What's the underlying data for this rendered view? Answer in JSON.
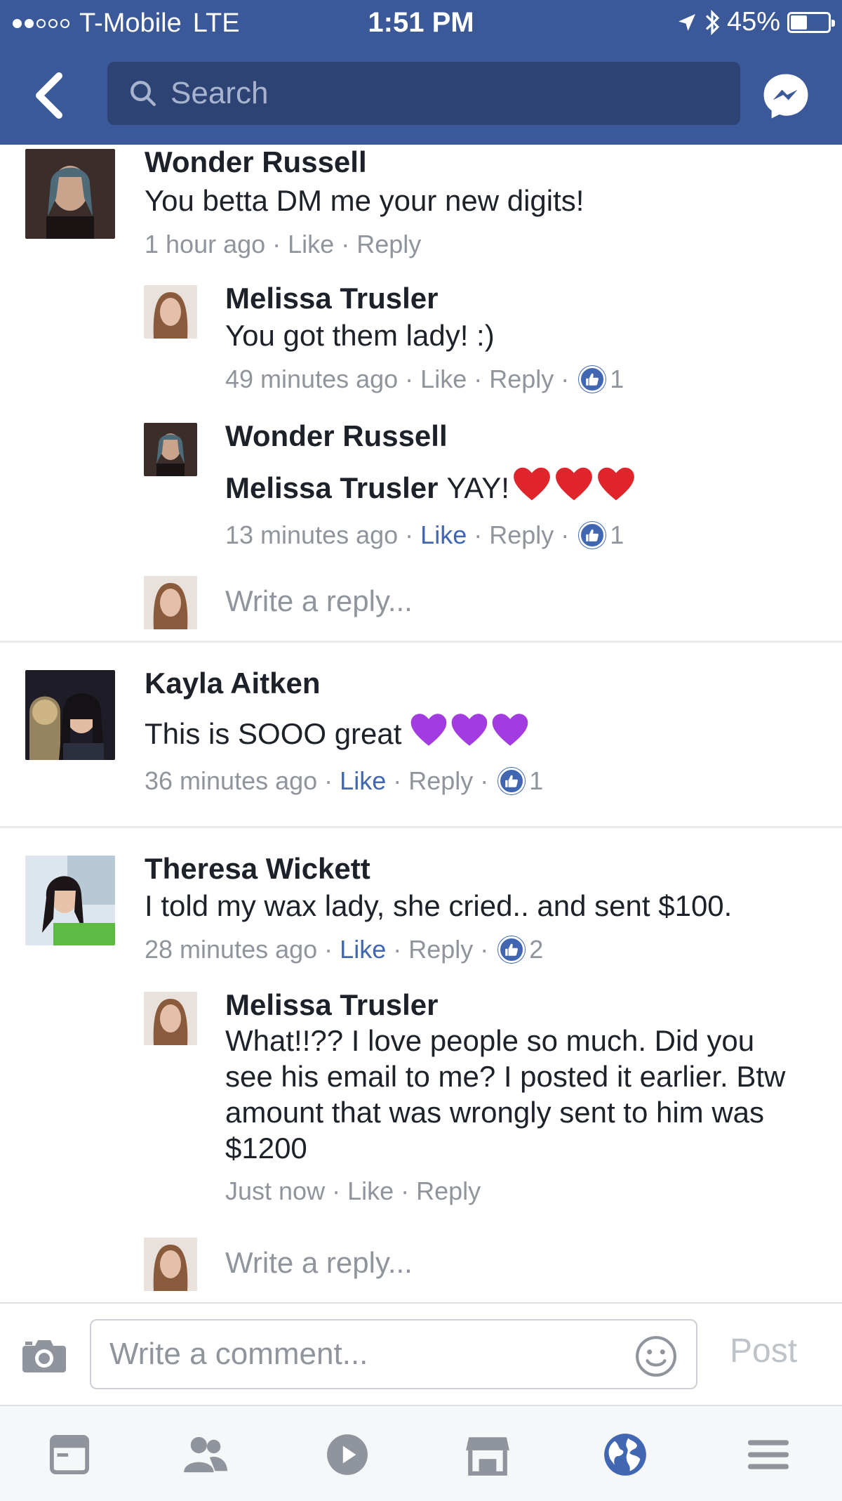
{
  "status": {
    "carrier": "T-Mobile",
    "network": "LTE",
    "time": "1:51 PM",
    "battery": "45%",
    "battery_level": 0.45
  },
  "nav": {
    "search_placeholder": "Search"
  },
  "comments": [
    {
      "name": "Wonder Russell",
      "text": "You betta DM me your new digits!",
      "time": "1 hour ago",
      "like": "Like",
      "reply": "Reply",
      "replies": [
        {
          "name": "Melissa Trusler",
          "text": "You got them lady! :)",
          "time": "49 minutes ago",
          "like": "Like",
          "reply": "Reply",
          "likes": "1"
        },
        {
          "name": "Wonder Russell",
          "mention": "Melissa Trusler",
          "text": "YAY!",
          "time": "13 minutes ago",
          "like": "Like",
          "reply": "Reply",
          "likes": "1"
        }
      ],
      "write_reply": "Write a reply..."
    },
    {
      "name": "Kayla Aitken",
      "text": "This is SOOO great",
      "time": "36 minutes ago",
      "like": "Like",
      "reply": "Reply",
      "likes": "1"
    },
    {
      "name": "Theresa Wickett",
      "text": "I told my wax lady, she cried.. and sent $100.",
      "time": "28 minutes ago",
      "like": "Like",
      "reply": "Reply",
      "likes": "2",
      "replies": [
        {
          "name": "Melissa Trusler",
          "text": "What!!?? I love people so much. Did you see his email to me? I posted it earlier. Btw amount that was wrongly sent to him was $1200",
          "time": "Just now",
          "like": "Like",
          "reply": "Reply"
        }
      ],
      "write_reply": "Write a reply..."
    }
  ],
  "composer": {
    "placeholder": "Write a comment...",
    "post_label": "Post"
  },
  "colors": {
    "brand": "#3b5998",
    "link": "#4267b2",
    "meta": "#90949c",
    "heart_red": "#e0242c",
    "heart_purple": "#a23be0"
  }
}
